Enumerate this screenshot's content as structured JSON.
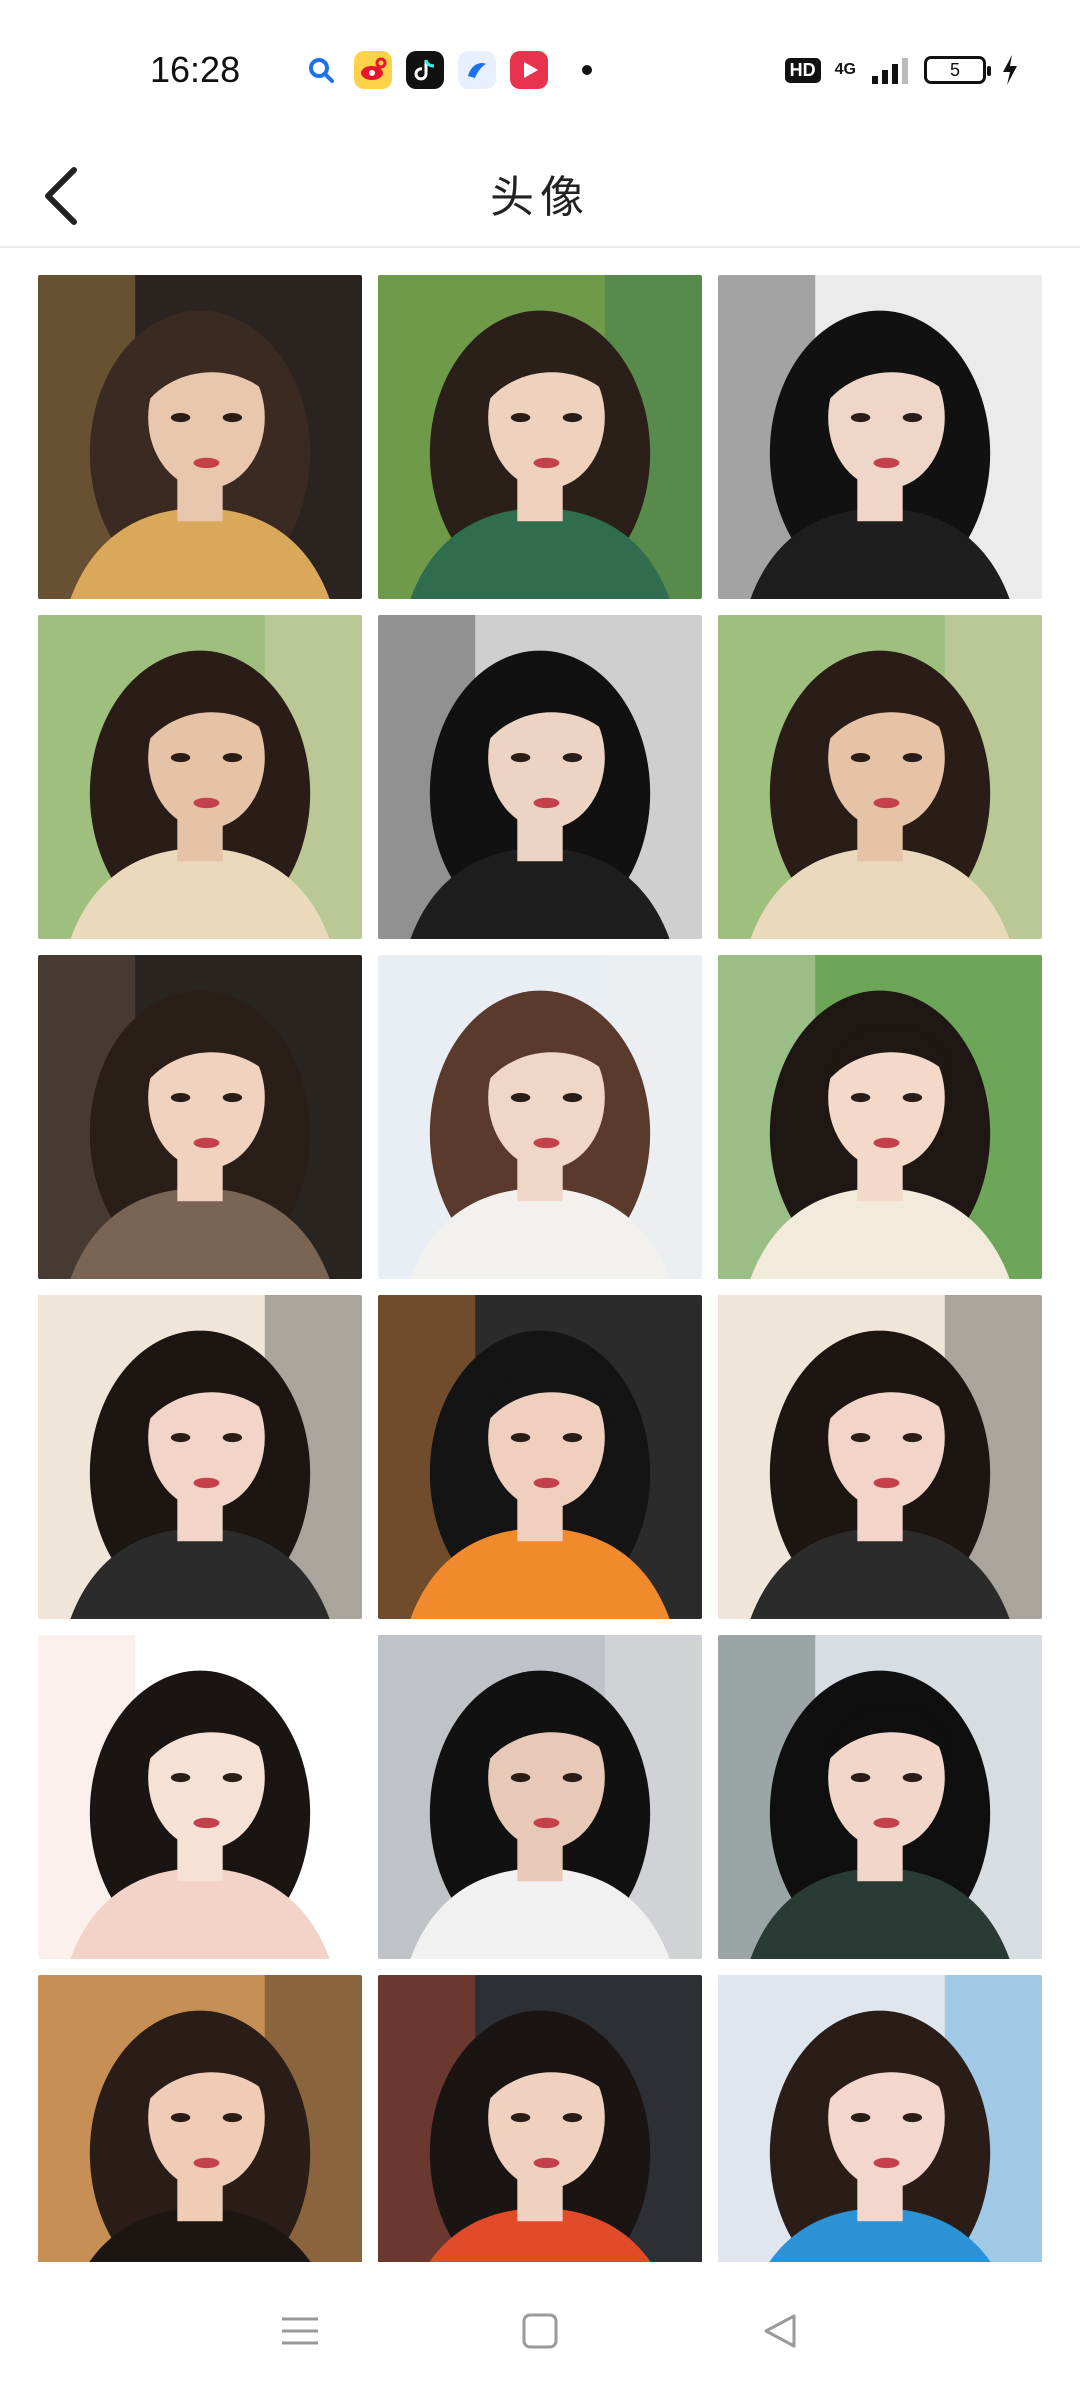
{
  "status_bar": {
    "time": "16:28",
    "hd": "HD",
    "network": "4G",
    "battery": "5",
    "notification_icons": [
      "search-icon",
      "weibo-icon",
      "tiktok-icon",
      "browser-icon",
      "video-icon"
    ]
  },
  "header": {
    "title": "头像",
    "back_icon": "chevron-left-icon"
  },
  "grid": {
    "columns": 3,
    "tiles": [
      {
        "bg": "#2b2320",
        "accent": "#d9a85a",
        "skin": "#e8c7ae",
        "hair": "#3a2a22"
      },
      {
        "bg": "#6f9a4a",
        "accent": "#2f6d4e",
        "skin": "#efd2bd",
        "hair": "#2b2019"
      },
      {
        "bg": "#ebebeb",
        "accent": "#1e1e1e",
        "skin": "#f0d6c8",
        "hair": "#111111"
      },
      {
        "bg": "#9fbf7e",
        "accent": "#ead9bc",
        "skin": "#e6c2a6",
        "hair": "#2a1d17"
      },
      {
        "bg": "#cfcfcf",
        "accent": "#1e1e1e",
        "skin": "#ecd3c4",
        "hair": "#111111"
      },
      {
        "bg": "#9fbf7e",
        "accent": "#ead9bc",
        "skin": "#e6c2a6",
        "hair": "#2a1d17"
      },
      {
        "bg": "#2a2421",
        "accent": "#7a6554",
        "skin": "#f1d2bf",
        "hair": "#2a1e18"
      },
      {
        "bg": "#e9eef4",
        "accent": "#f3f1ee",
        "skin": "#f0d6c7",
        "hair": "#5a3a2c"
      },
      {
        "bg": "#6da559",
        "accent": "#f2eadb",
        "skin": "#f4d8c8",
        "hair": "#1f1714"
      },
      {
        "bg": "#f0e5d9",
        "accent": "#2b2b2b",
        "skin": "#f2d5c8",
        "hair": "#1d1512"
      },
      {
        "bg": "#2b2b2b",
        "accent": "#f08a2d",
        "skin": "#f0cfbf",
        "hair": "#141414"
      },
      {
        "bg": "#f0e5d9",
        "accent": "#2b2b2b",
        "skin": "#f2d5c8",
        "hair": "#1d1512"
      },
      {
        "bg": "#ffffff",
        "accent": "#f3d3c8",
        "skin": "#f6e1d5",
        "hair": "#1a1412"
      },
      {
        "bg": "#bfc2c7",
        "accent": "#f1f1f1",
        "skin": "#e8c8b7",
        "hair": "#111111"
      },
      {
        "bg": "#d7dde2",
        "accent": "#2a3b35",
        "skin": "#f2d6ca",
        "hair": "#0f0f10"
      },
      {
        "bg": "#c58f55",
        "accent": "#1c1512",
        "skin": "#f0cbb6",
        "hair": "#2a1d17"
      },
      {
        "bg": "#2c2f33",
        "accent": "#e24b2a",
        "skin": "#f0d0bf",
        "hair": "#1a1412"
      },
      {
        "bg": "#dfe6ee",
        "accent": "#2b92d6",
        "skin": "#f3d7cc",
        "hair": "#2a1d17"
      }
    ]
  },
  "nav_bar": {
    "items": [
      "menu-icon",
      "home-square-icon",
      "back-triangle-icon"
    ]
  }
}
